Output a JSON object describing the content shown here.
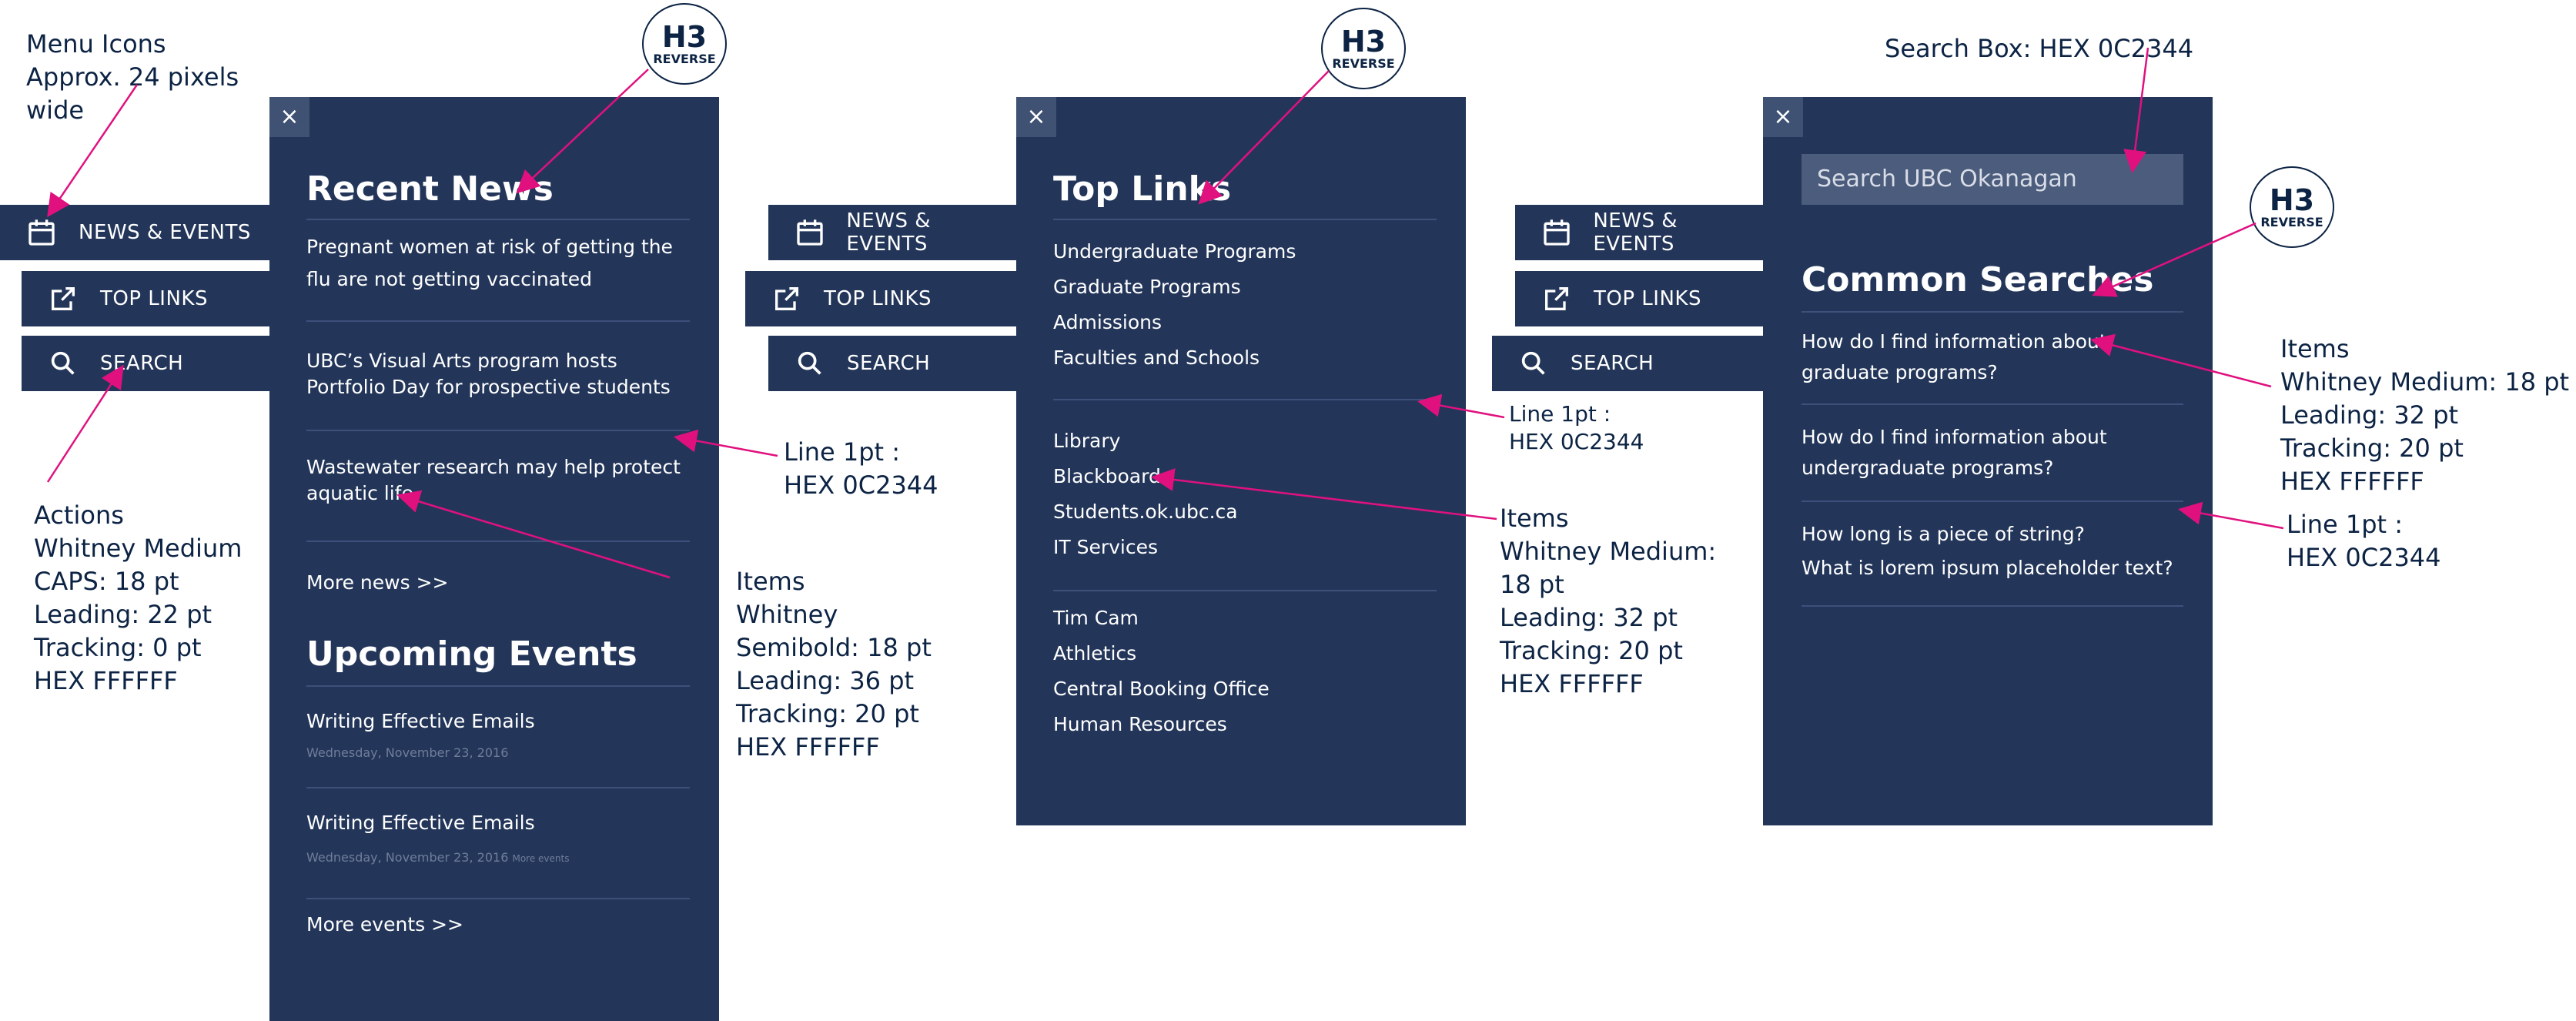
{
  "colors": {
    "panel": "#23365a",
    "annotation": "#0c2344",
    "arrow": "#e0117f",
    "text": "#FFFFFF"
  },
  "badge": {
    "heading": "H3",
    "sub": "REVERSE"
  },
  "close_glyph": "×",
  "annotations": {
    "menu_icons": "Menu Icons\nApprox. 24 pixels\nwide",
    "actions": "Actions\nWhitney Medium\nCAPS: 18 pt\nLeading: 22 pt\nTracking: 0 pt\nHEX FFFFFF",
    "line_news": "Line 1pt :\nHEX 0C2344",
    "items_news": "Items\nWhitney\nSemibold: 18 pt\nLeading: 36 pt\nTracking: 20 pt\nHEX FFFFFF",
    "line_links": "Line 1pt :\nHEX 0C2344",
    "items_links": "Items\nWhitney Medium:\n18 pt\nLeading: 32 pt\nTracking: 20 pt\nHEX FFFFFF",
    "search_box": "Search Box: HEX 0C2344",
    "items_search": "Items\nWhitney Medium: 18 pt\nLeading: 32 pt\nTracking: 20 pt\nHEX FFFFFF",
    "line_search": "Line 1pt :\nHEX 0C2344"
  },
  "tabs": {
    "news": {
      "label": "NEWS & EVENTS",
      "icon": "calendar-icon"
    },
    "links": {
      "label": "TOP LINKS",
      "icon": "external-link-icon"
    },
    "search": {
      "label": "SEARCH",
      "icon": "search-icon"
    }
  },
  "news_panel": {
    "recent_title": "Recent News",
    "news": [
      {
        "line1": "Pregnant women at risk of getting the",
        "line2": "flu are not getting vaccinated"
      },
      {
        "line1": "UBC’s Visual Arts program hosts",
        "line2": "Portfolio Day for prospective students"
      },
      {
        "line1": "Wastewater research may help protect",
        "line2": "aquatic life"
      }
    ],
    "more_news": "More news >>",
    "events_title": "Upcoming Events",
    "events": [
      {
        "title": "Writing Effective Emails",
        "date": "Wednesday, November 23, 2016",
        "extra": ""
      },
      {
        "title": "Writing Effective Emails",
        "date": "Wednesday, November 23, 2016",
        "extra": "More events"
      }
    ],
    "more_events": "More events >>"
  },
  "links_panel": {
    "title": "Top Links",
    "group1": [
      "Undergraduate Programs",
      "Graduate Programs",
      "Admissions",
      "Faculties and Schools"
    ],
    "group2": [
      "Library",
      "Blackboard",
      "Students.ok.ubc.ca",
      "IT Services"
    ],
    "group3": [
      "Tim Cam",
      "Athletics",
      "Central Booking Office",
      "Human Resources"
    ]
  },
  "search_panel": {
    "placeholder": "Search UBC Okanagan",
    "title": "Common Searches",
    "items": [
      {
        "line1": "How do I find information about",
        "line2": "graduate programs?"
      },
      {
        "line1": "How do I find information about",
        "line2": "undergraduate programs?"
      },
      {
        "line1": "How long is a piece of string?",
        "line2": "What is lorem ipsum placeholder text?"
      }
    ]
  }
}
